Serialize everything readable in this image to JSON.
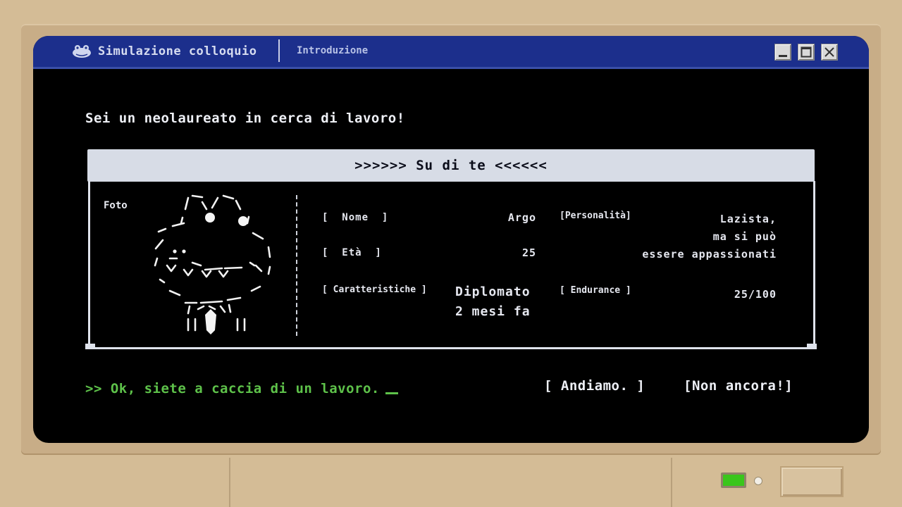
{
  "window": {
    "title": "Simulazione colloquio",
    "tab": "Introduzione",
    "icon": "frog-icon"
  },
  "intro_text": "Sei un neolaureato in cerca di lavoro!",
  "panel": {
    "header": ">>>>>> Su di te <<<<<<",
    "photo_label": "Foto",
    "fields": {
      "name_label": "[  Nome  ]",
      "name_value": "Argo",
      "age_label": "[  Età  ]",
      "age_value": "25",
      "traits_label": "[ Caratteristiche ]",
      "traits_value_line1": "Diplomato",
      "traits_value_line2": "2 mesi fa",
      "personality_label": "[Personalità]",
      "personality_value_line1": "Lazista,",
      "personality_value_line2": "ma si può",
      "personality_value_line3": "essere appassionati",
      "endurance_label": "[ Endurance ]",
      "endurance_value": "25/100"
    }
  },
  "prompt_text": ">> Ok, siete a caccia di un lavoro.",
  "actions": {
    "go": "[ Andiamo. ]",
    "not_yet": "[Non ancora!]"
  },
  "colors": {
    "screen_bg": "#000000",
    "titlebar": "#1c2f8c",
    "prompt_green": "#5ec24a",
    "panel_header_bg": "#d7dce6",
    "led": "#3ac61c",
    "case": "#d4bc96"
  }
}
